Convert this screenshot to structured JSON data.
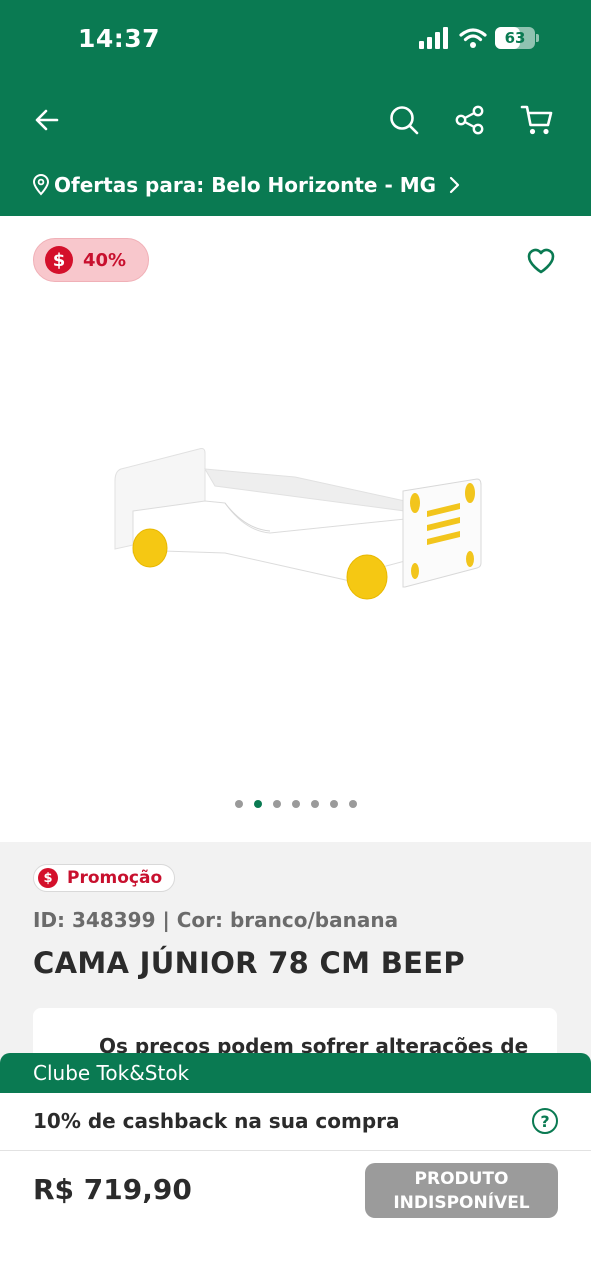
{
  "status_bar": {
    "time": "14:37",
    "battery": "63",
    "battery_level": 0.63
  },
  "header": {
    "icons": [
      "arrow-left-icon",
      "search-icon",
      "share-icon",
      "cart-icon"
    ],
    "location_label": "Ofertas para: Belo Horizonte - MG",
    "background_color": "#0a7a52"
  },
  "product": {
    "discount": "40%",
    "promo_label": "Promoção",
    "meta": "ID: 348399 | Cor: branco/banana",
    "title": "CAMA JÚNIOR 78 CM BEEP",
    "image_count": 7,
    "active_image_index": 1,
    "notice": "Os preços podem sofrer alterações de"
  },
  "club": {
    "header": "Clube Tok&Stok",
    "cashback": "10% de cashback na sua compra",
    "help_icon": "?"
  },
  "purchase": {
    "price": "R$ 719,90",
    "button_label": "PRODUTO INDISPONÍVEL"
  },
  "colors": {
    "brand_green": "#0a7a52",
    "discount_red": "#c8102e",
    "discount_badge_bg": "#f8c7cc",
    "disabled_button": "#9b9b9b"
  }
}
